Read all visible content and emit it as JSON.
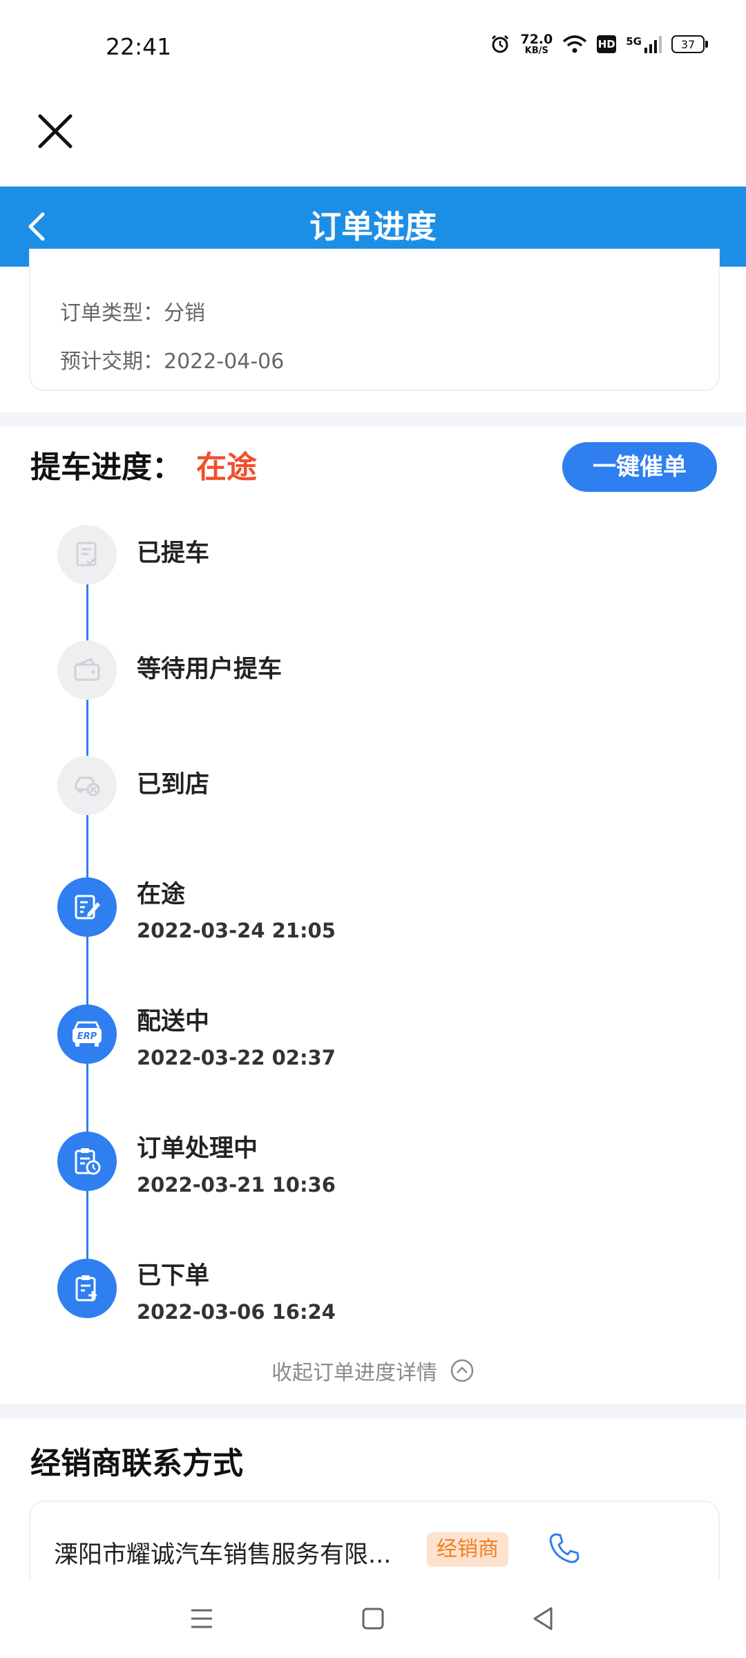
{
  "status_bar": {
    "time": "22:41",
    "net_speed": "72.0",
    "net_unit": "KB/S",
    "hd": "HD",
    "network": "5G",
    "battery": "37"
  },
  "header": {
    "title": "订单进度"
  },
  "order_info": {
    "type_label": "订单类型：分销",
    "delivery_label": "预计交期：2022-04-06"
  },
  "progress": {
    "title": "提车进度：",
    "status": "在途",
    "urge_button": "一键催单",
    "steps": [
      {
        "name": "已提车",
        "time": "",
        "icon": "document-check-icon",
        "active": false
      },
      {
        "name": "等待用户提车",
        "time": "",
        "icon": "wallet-icon",
        "active": false
      },
      {
        "name": "已到店",
        "time": "",
        "icon": "car-icon",
        "active": false
      },
      {
        "name": "在途",
        "time": "2022-03-24 21:05",
        "icon": "edit-document-icon",
        "active": true
      },
      {
        "name": "配送中",
        "time": "2022-03-22 02:37",
        "icon": "erp-icon",
        "active": true
      },
      {
        "name": "订单处理中",
        "time": "2022-03-21 10:36",
        "icon": "clipboard-clock-icon",
        "active": true
      },
      {
        "name": "已下单",
        "time": "2022-03-06 16:24",
        "icon": "clipboard-add-icon",
        "active": true
      }
    ],
    "erp_text": "ERP",
    "collapse_label": "收起订单进度详情"
  },
  "dealer": {
    "title": "经销商联系方式",
    "name": "溧阳市耀诚汽车销售服务有限...",
    "tag": "经销商"
  },
  "colors": {
    "header_blue": "#1d8ee6",
    "accent_blue": "#2f7ff0",
    "status_red": "#f0502b",
    "tag_orange": "#f08022"
  }
}
